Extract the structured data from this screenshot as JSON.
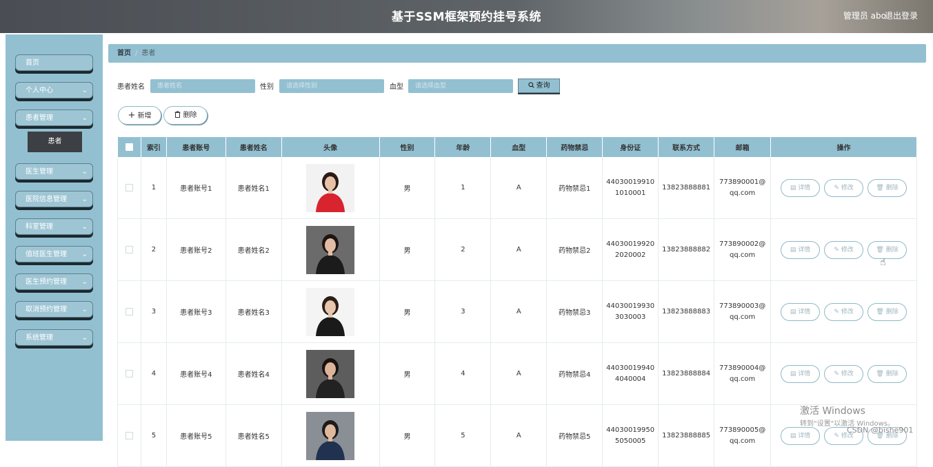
{
  "header": {
    "title": "基于SSM框架预约挂号系统",
    "admin": "管理员 abo",
    "logout": "退出登录"
  },
  "sidebar": {
    "items": [
      {
        "label": "首页",
        "has_chevron": false
      },
      {
        "label": "个人中心",
        "has_chevron": true
      },
      {
        "label": "患者管理",
        "has_chevron": true
      },
      {
        "label": "医生管理",
        "has_chevron": true
      },
      {
        "label": "医院信息管理",
        "has_chevron": true
      },
      {
        "label": "科室管理",
        "has_chevron": true
      },
      {
        "label": "值班医生管理",
        "has_chevron": true
      },
      {
        "label": "医生预约管理",
        "has_chevron": true
      },
      {
        "label": "取消预约管理",
        "has_chevron": true
      },
      {
        "label": "系统管理",
        "has_chevron": true
      }
    ],
    "submenu": {
      "label": "患者"
    },
    "chevron": "⌄"
  },
  "breadcrumb": {
    "home": "首页",
    "sep": "/",
    "current": "患者"
  },
  "search": {
    "name_label": "患者姓名",
    "name_placeholder": "患者姓名",
    "gender_label": "性别",
    "gender_placeholder": "请选择性别",
    "blood_label": "血型",
    "blood_placeholder": "请选择血型",
    "query_label": "查询"
  },
  "actions": {
    "add_label": "新增",
    "delete_label": "删除"
  },
  "table": {
    "headers": [
      "索引",
      "患者账号",
      "患者姓名",
      "头像",
      "性别",
      "年龄",
      "血型",
      "药物禁忌",
      "身份证",
      "联系方式",
      "邮箱",
      "操作"
    ],
    "op_labels": {
      "detail": "详情",
      "edit": "修改",
      "delete": "删除"
    },
    "rows": [
      {
        "index": "1",
        "account": "患者账号1",
        "name": "患者姓名1",
        "gender": "男",
        "age": "1",
        "blood": "A",
        "taboo": "药物禁忌1",
        "id_line1": "44030019910",
        "id_line2": "1010001",
        "phone": "13823888881",
        "email_line1": "773890001@",
        "email_line2": "qq.com"
      },
      {
        "index": "2",
        "account": "患者账号2",
        "name": "患者姓名2",
        "gender": "男",
        "age": "2",
        "blood": "A",
        "taboo": "药物禁忌2",
        "id_line1": "44030019920",
        "id_line2": "2020002",
        "phone": "13823888882",
        "email_line1": "773890002@",
        "email_line2": "qq.com"
      },
      {
        "index": "3",
        "account": "患者账号3",
        "name": "患者姓名3",
        "gender": "男",
        "age": "3",
        "blood": "A",
        "taboo": "药物禁忌3",
        "id_line1": "44030019930",
        "id_line2": "3030003",
        "phone": "13823888883",
        "email_line1": "773890003@",
        "email_line2": "qq.com"
      },
      {
        "index": "4",
        "account": "患者账号4",
        "name": "患者姓名4",
        "gender": "男",
        "age": "4",
        "blood": "A",
        "taboo": "药物禁忌4",
        "id_line1": "44030019940",
        "id_line2": "4040004",
        "phone": "13823888884",
        "email_line1": "773890004@",
        "email_line2": "qq.com"
      },
      {
        "index": "5",
        "account": "患者账号5",
        "name": "患者姓名5",
        "gender": "男",
        "age": "5",
        "blood": "A",
        "taboo": "药物禁忌5",
        "id_line1": "44030019950",
        "id_line2": "5050005",
        "phone": "13823888885",
        "email_line1": "773890005@",
        "email_line2": "qq.com"
      }
    ]
  },
  "watermark": {
    "line1": "激活 Windows",
    "line2": "转到\"设置\"以激活 Windows。",
    "csdn": "CSDN @bishe901"
  },
  "colors": {
    "accent": "#93c0d1",
    "sidebar_bg": "#93c0d1",
    "submenu_bg": "#3c3f43"
  }
}
